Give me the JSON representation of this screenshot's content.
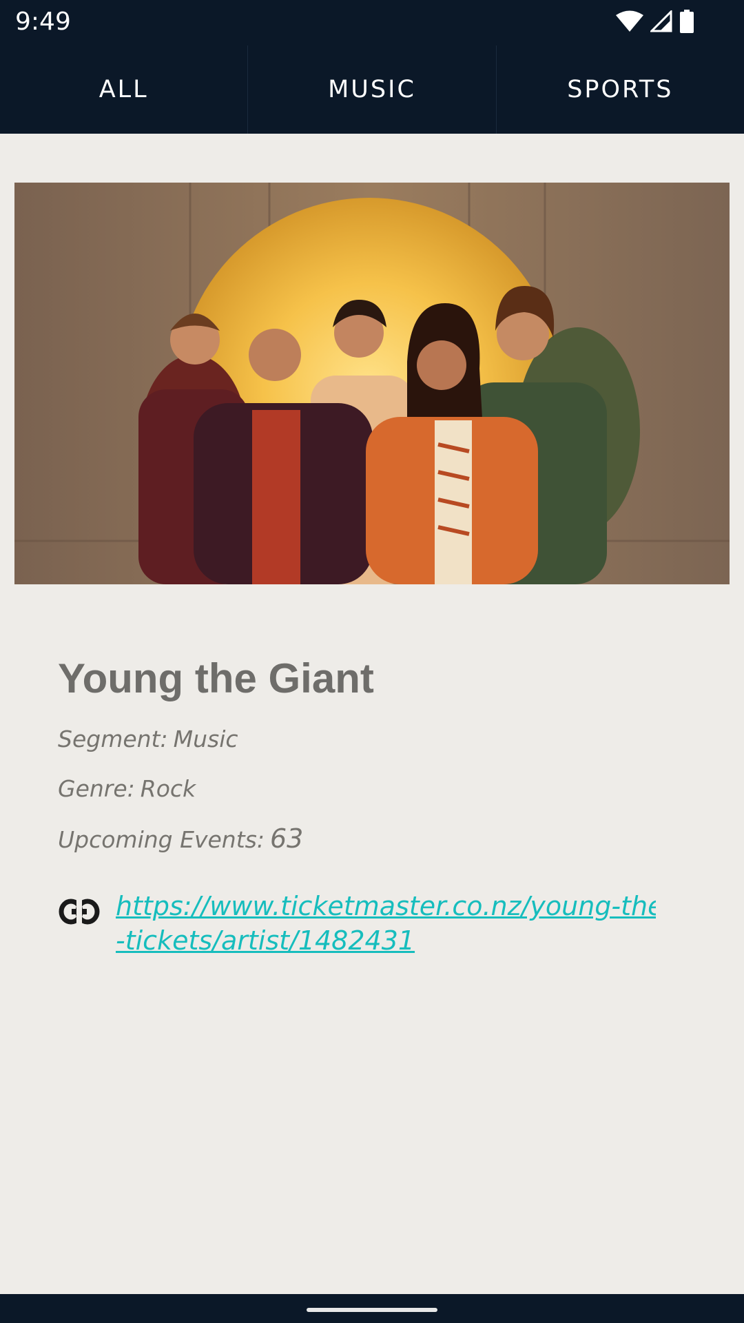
{
  "status_bar": {
    "time": "9:49",
    "icons": [
      "wifi-icon",
      "signal-icon",
      "battery-icon"
    ]
  },
  "tabs": [
    {
      "label": "ALL"
    },
    {
      "label": "MUSIC"
    },
    {
      "label": "SPORTS"
    }
  ],
  "artist": {
    "name": "Young the Giant",
    "segment_label": "Segment:",
    "segment_value": "Music",
    "genre_label": "Genre:",
    "genre_value": "Rock",
    "events_label": "Upcoming Events:",
    "events_value": "63",
    "url_line1": "https://www.ticketmaster.co.nz/young-the-giant",
    "url_line2": "-tickets/artist/1482431"
  },
  "colors": {
    "header_bg": "#0b1828",
    "page_bg": "#eeece8",
    "link": "#16bdbd",
    "text_gray": "#6e6d6a"
  }
}
